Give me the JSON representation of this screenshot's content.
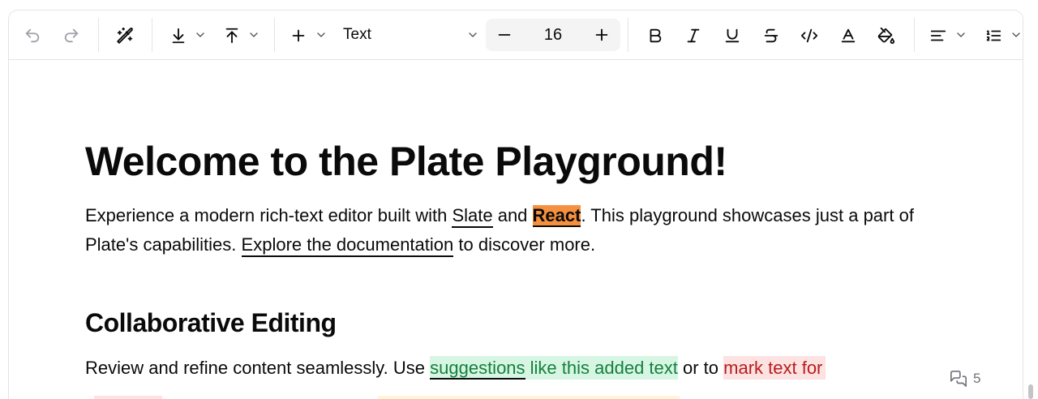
{
  "toolbar": {
    "buttons": [
      {
        "id": "undo",
        "icon": "undo-icon"
      },
      {
        "id": "redo",
        "icon": "redo-icon"
      },
      {
        "id": "ai",
        "icon": "magic-wand-icon"
      },
      {
        "id": "import",
        "icon": "arrow-down-to-line-icon"
      },
      {
        "id": "export",
        "icon": "arrow-up-to-line-icon"
      },
      {
        "id": "insert",
        "icon": "plus-icon"
      }
    ],
    "turn_into_label": "Text",
    "font_size": "16",
    "marks": [
      "bold-icon",
      "italic-icon",
      "underline-icon",
      "strikethrough-icon",
      "code-icon",
      "font-color-icon",
      "highlight-paint-bucket-icon"
    ],
    "align_icon": "align-left-icon",
    "list_icon": "ordered-list-icon"
  },
  "editor": {
    "title": "Welcome to the Plate Playground!",
    "p1": {
      "part1": "Experience a modern rich-text editor built with ",
      "slate": "Slate",
      "and": " and ",
      "react": "React",
      "part2": ". This playground showcases just a part of Plate's capabilities. ",
      "doc_link": "Explore the documentation",
      "part3": " to discover more."
    },
    "h2": "Collaborative Editing",
    "p2": {
      "part1": "Review and refine content seamlessly. Use ",
      "suggestions": "suggestions",
      "added": " like this added text",
      "or": " or to ",
      "mark_del": "mark text for "
    },
    "comment_count": "5"
  },
  "colors": {
    "react_highlight": "#f4903e",
    "suggestion_add_bg": "#d6f5e3",
    "suggestion_add_text": "#15803d",
    "suggestion_del_bg": "#fde2e2",
    "suggestion_del_text": "#b91c1c"
  }
}
